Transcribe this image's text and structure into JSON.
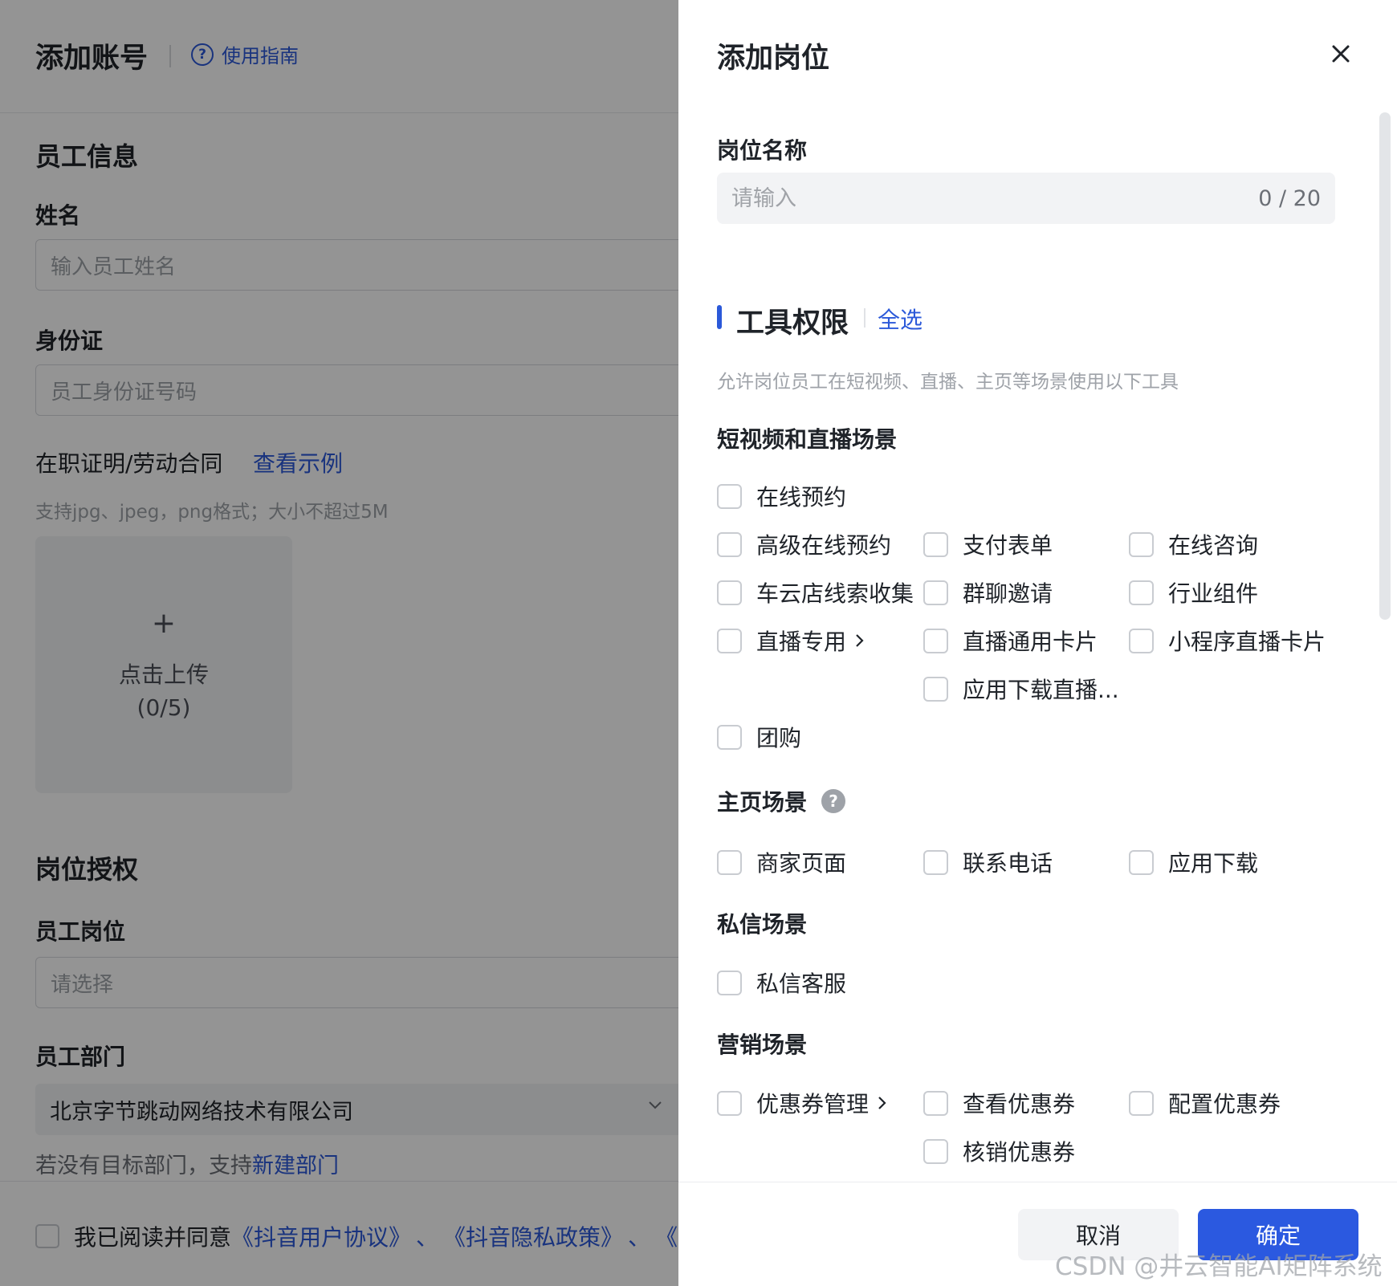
{
  "background_page": {
    "title": "添加账号",
    "guide_link": "使用指南",
    "employee_section": "员工信息",
    "name_label": "姓名",
    "name_placeholder": "输入员工姓名",
    "id_label": "身份证",
    "id_placeholder": "员工身份证号码",
    "cert_label": "在职证明/劳动合同",
    "cert_example_link": "查看示例",
    "upload_hint": "支持jpg、jpeg，png格式；大小不超过5M",
    "upload_plus": "+",
    "upload_label": "点击上传",
    "upload_count": "(0/5)",
    "auth_section": "岗位授权",
    "position_label": "员工岗位",
    "position_placeholder": "请选择",
    "dept_label": "员工部门",
    "dept_value": "北京字节跳动网络技术有限公司",
    "dept_hint_prefix": "若没有目标部门，支持",
    "dept_hint_link": "新建部门",
    "agree_text": "我已阅读并同意",
    "agree_link_1": "《抖音用户协议》",
    "agree_sep_1": "、",
    "agree_link_2": "《抖音隐私政策》",
    "agree_sep_2": "、",
    "agree_link_3": "《企"
  },
  "drawer": {
    "title": "添加岗位",
    "close_icon": "close-icon",
    "position_name_label": "岗位名称",
    "position_name_placeholder": "请输入",
    "position_name_count": "0 / 20",
    "tools_title": "工具权限",
    "select_all": "全选",
    "tools_desc": "允许岗位员工在短视频、直播、主页等场景使用以下工具",
    "groups": {
      "video_live": {
        "title": "短视频和直播场景",
        "options": [
          "在线预约",
          "高级在线预约",
          "支付表单",
          "在线咨询",
          "车云店线索收集",
          "群聊邀请",
          "行业组件",
          "直播专用",
          "直播通用卡片",
          "小程序直播卡片",
          "应用下载直播...",
          "团购"
        ]
      },
      "homepage": {
        "title": "主页场景",
        "help_icon": "help-icon",
        "options": [
          "商家页面",
          "联系电话",
          "应用下载"
        ]
      },
      "private_msg": {
        "title": "私信场景",
        "options": [
          "私信客服"
        ]
      },
      "marketing": {
        "title": "营销场景",
        "options": [
          "优惠券管理",
          "查看优惠券",
          "配置优惠券",
          "核销优惠券"
        ]
      }
    },
    "cancel_label": "取消",
    "confirm_label": "确定"
  },
  "watermark": "CSDN @井云智能AI矩阵系统",
  "colors": {
    "accent": "#2b59d9",
    "primary_button": "#2b59e0",
    "overlay": "rgba(0,0,0,0.42)"
  }
}
